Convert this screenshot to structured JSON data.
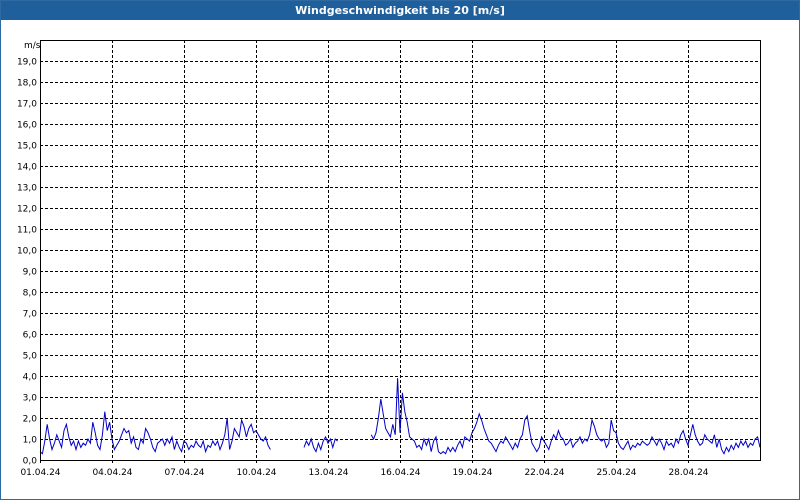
{
  "window": {
    "title": "Windgeschwindigkeit bis 20 [m/s]"
  },
  "chart_data": {
    "type": "line",
    "title": "Windgeschwindigkeit bis 20 [m/s]",
    "ylabel": "m/s",
    "xlabel": "",
    "ylim": [
      0,
      20
    ],
    "xlim_days": [
      0,
      30
    ],
    "grid": true,
    "y_ticks": [
      "0,0",
      "1,0",
      "2,0",
      "3,0",
      "4,0",
      "5,0",
      "6,0",
      "7,0",
      "8,0",
      "9,0",
      "10,0",
      "11,0",
      "12,0",
      "13,0",
      "14,0",
      "15,0",
      "16,0",
      "17,0",
      "18,0",
      "19,0"
    ],
    "x_ticks": [
      "01.04.24",
      "04.04.24",
      "07.04.24",
      "10.04.24",
      "13.04.24",
      "16.04.24",
      "19.04.24",
      "22.04.24",
      "25.04.24",
      "28.04.24"
    ],
    "colors": {
      "series": "#0000c8",
      "title_bar": "#1e5f9c"
    },
    "series": [
      {
        "segments": [
          [
            [
              0.0,
              0.4
            ],
            [
              0.1,
              0.3
            ],
            [
              0.2,
              0.9
            ],
            [
              0.3,
              1.7
            ],
            [
              0.4,
              1.0
            ],
            [
              0.5,
              0.5
            ],
            [
              0.6,
              0.8
            ],
            [
              0.7,
              1.2
            ],
            [
              0.8,
              0.9
            ],
            [
              0.9,
              0.6
            ],
            [
              1.0,
              1.4
            ],
            [
              1.1,
              1.7
            ],
            [
              1.2,
              1.1
            ],
            [
              1.3,
              0.7
            ],
            [
              1.4,
              0.9
            ],
            [
              1.5,
              0.5
            ],
            [
              1.6,
              0.9
            ],
            [
              1.7,
              0.6
            ],
            [
              1.8,
              0.8
            ],
            [
              1.9,
              0.7
            ],
            [
              2.0,
              1.0
            ],
            [
              2.1,
              0.8
            ],
            [
              2.2,
              1.8
            ],
            [
              2.3,
              1.3
            ],
            [
              2.4,
              0.7
            ],
            [
              2.5,
              0.5
            ],
            [
              2.6,
              1.2
            ],
            [
              2.7,
              2.3
            ],
            [
              2.8,
              1.4
            ],
            [
              2.9,
              1.8
            ],
            [
              3.0,
              1.0
            ],
            [
              3.1,
              0.5
            ],
            [
              3.2,
              0.7
            ],
            [
              3.3,
              0.9
            ],
            [
              3.4,
              1.2
            ],
            [
              3.5,
              1.5
            ],
            [
              3.6,
              1.3
            ],
            [
              3.7,
              1.4
            ],
            [
              3.8,
              0.8
            ],
            [
              3.9,
              1.1
            ],
            [
              4.0,
              0.6
            ],
            [
              4.1,
              0.5
            ],
            [
              4.2,
              1.0
            ],
            [
              4.3,
              0.8
            ],
            [
              4.4,
              1.5
            ],
            [
              4.5,
              1.3
            ],
            [
              4.6,
              1.0
            ],
            [
              4.7,
              0.6
            ],
            [
              4.8,
              0.4
            ],
            [
              4.9,
              0.8
            ],
            [
              5.0,
              0.9
            ],
            [
              5.1,
              1.0
            ],
            [
              5.2,
              0.7
            ],
            [
              5.3,
              1.0
            ],
            [
              5.4,
              0.8
            ],
            [
              5.5,
              1.1
            ],
            [
              5.6,
              0.5
            ],
            [
              5.7,
              0.9
            ],
            [
              5.8,
              0.6
            ],
            [
              5.9,
              0.4
            ],
            [
              6.0,
              0.9
            ],
            [
              6.1,
              0.8
            ],
            [
              6.2,
              0.5
            ],
            [
              6.3,
              0.7
            ],
            [
              6.4,
              0.6
            ],
            [
              6.5,
              0.9
            ],
            [
              6.6,
              0.7
            ],
            [
              6.7,
              0.6
            ],
            [
              6.8,
              0.9
            ],
            [
              6.9,
              0.4
            ],
            [
              7.0,
              0.7
            ],
            [
              7.1,
              0.6
            ],
            [
              7.2,
              0.9
            ],
            [
              7.3,
              0.7
            ],
            [
              7.4,
              0.9
            ],
            [
              7.5,
              0.5
            ],
            [
              7.6,
              0.8
            ],
            [
              7.7,
              1.2
            ],
            [
              7.8,
              2.0
            ],
            [
              7.9,
              0.5
            ],
            [
              8.0,
              0.9
            ],
            [
              8.1,
              1.5
            ],
            [
              8.2,
              1.3
            ],
            [
              8.3,
              1.1
            ],
            [
              8.4,
              1.9
            ],
            [
              8.5,
              1.6
            ],
            [
              8.6,
              1.1
            ],
            [
              8.7,
              1.5
            ],
            [
              8.8,
              1.7
            ],
            [
              8.9,
              1.3
            ],
            [
              9.0,
              1.4
            ],
            [
              9.1,
              1.2
            ],
            [
              9.2,
              1.0
            ],
            [
              9.3,
              0.9
            ],
            [
              9.4,
              1.1
            ],
            [
              9.5,
              0.7
            ],
            [
              9.6,
              0.5
            ]
          ],
          [
            [
              11.0,
              0.6
            ],
            [
              11.1,
              0.9
            ],
            [
              11.2,
              0.7
            ],
            [
              11.3,
              1.0
            ],
            [
              11.4,
              0.6
            ],
            [
              11.5,
              0.4
            ],
            [
              11.6,
              0.8
            ],
            [
              11.7,
              0.5
            ],
            [
              11.8,
              0.9
            ],
            [
              11.9,
              1.1
            ],
            [
              12.0,
              0.8
            ],
            [
              12.1,
              1.0
            ],
            [
              12.2,
              0.6
            ],
            [
              12.3,
              1.0
            ],
            [
              12.4,
              0.9
            ]
          ],
          [
            [
              13.8,
              1.2
            ],
            [
              13.9,
              1.0
            ],
            [
              14.0,
              1.3
            ],
            [
              14.1,
              2.0
            ],
            [
              14.2,
              2.9
            ],
            [
              14.3,
              2.2
            ],
            [
              14.4,
              1.5
            ],
            [
              14.5,
              1.3
            ],
            [
              14.6,
              1.1
            ],
            [
              14.7,
              1.7
            ],
            [
              14.8,
              1.2
            ],
            [
              14.9,
              3.9
            ],
            [
              15.0,
              1.3
            ],
            [
              15.1,
              3.2
            ],
            [
              15.2,
              2.3
            ],
            [
              15.3,
              1.8
            ],
            [
              15.4,
              1.1
            ],
            [
              15.5,
              1.0
            ],
            [
              15.6,
              0.9
            ],
            [
              15.7,
              0.6
            ],
            [
              15.8,
              0.7
            ],
            [
              15.9,
              0.5
            ],
            [
              16.0,
              1.0
            ],
            [
              16.1,
              0.7
            ],
            [
              16.2,
              1.0
            ],
            [
              16.3,
              0.4
            ],
            [
              16.4,
              0.9
            ],
            [
              16.5,
              1.1
            ],
            [
              16.6,
              0.4
            ],
            [
              16.7,
              0.3
            ],
            [
              16.8,
              0.4
            ],
            [
              16.9,
              0.3
            ],
            [
              17.0,
              0.6
            ],
            [
              17.1,
              0.4
            ],
            [
              17.2,
              0.6
            ],
            [
              17.3,
              0.4
            ],
            [
              17.4,
              0.7
            ],
            [
              17.5,
              0.9
            ],
            [
              17.6,
              0.6
            ],
            [
              17.7,
              1.1
            ],
            [
              17.8,
              1.0
            ],
            [
              17.9,
              0.9
            ],
            [
              18.0,
              1.3
            ],
            [
              18.1,
              1.5
            ],
            [
              18.2,
              1.8
            ],
            [
              18.3,
              2.2
            ],
            [
              18.4,
              1.9
            ],
            [
              18.5,
              1.5
            ],
            [
              18.6,
              1.2
            ],
            [
              18.7,
              0.9
            ],
            [
              18.8,
              0.8
            ],
            [
              18.9,
              0.6
            ],
            [
              19.0,
              0.4
            ],
            [
              19.1,
              0.7
            ],
            [
              19.2,
              0.9
            ],
            [
              19.3,
              0.8
            ],
            [
              19.4,
              1.1
            ],
            [
              19.5,
              0.9
            ],
            [
              19.6,
              0.7
            ],
            [
              19.7,
              0.5
            ],
            [
              19.8,
              0.8
            ],
            [
              19.9,
              0.6
            ],
            [
              20.0,
              1.0
            ],
            [
              20.1,
              1.2
            ],
            [
              20.2,
              1.9
            ],
            [
              20.3,
              2.1
            ],
            [
              20.4,
              1.4
            ],
            [
              20.5,
              0.8
            ],
            [
              20.6,
              0.6
            ],
            [
              20.7,
              0.4
            ],
            [
              20.8,
              0.6
            ],
            [
              20.9,
              1.1
            ],
            [
              21.0,
              0.9
            ],
            [
              21.1,
              0.7
            ],
            [
              21.2,
              0.5
            ],
            [
              21.3,
              0.9
            ],
            [
              21.4,
              1.2
            ],
            [
              21.5,
              1.0
            ],
            [
              21.6,
              1.4
            ],
            [
              21.7,
              1.1
            ],
            [
              21.8,
              1.0
            ],
            [
              21.9,
              0.7
            ],
            [
              22.0,
              0.8
            ],
            [
              22.1,
              1.0
            ],
            [
              22.2,
              0.6
            ],
            [
              22.3,
              0.8
            ],
            [
              22.4,
              0.9
            ],
            [
              22.5,
              1.1
            ],
            [
              22.6,
              0.8
            ],
            [
              22.7,
              1.0
            ],
            [
              22.8,
              0.9
            ],
            [
              22.9,
              1.2
            ],
            [
              23.0,
              1.9
            ],
            [
              23.1,
              1.6
            ],
            [
              23.2,
              1.2
            ],
            [
              23.3,
              1.0
            ],
            [
              23.4,
              0.9
            ],
            [
              23.5,
              1.0
            ],
            [
              23.6,
              0.6
            ],
            [
              23.7,
              0.8
            ],
            [
              23.8,
              1.9
            ],
            [
              23.9,
              1.4
            ],
            [
              24.0,
              1.3
            ],
            [
              24.1,
              0.8
            ],
            [
              24.2,
              0.6
            ],
            [
              24.3,
              0.5
            ],
            [
              24.4,
              0.7
            ],
            [
              24.5,
              0.9
            ],
            [
              24.6,
              0.5
            ],
            [
              24.7,
              0.7
            ],
            [
              24.8,
              0.6
            ],
            [
              24.9,
              0.8
            ],
            [
              25.0,
              0.7
            ],
            [
              25.1,
              0.9
            ],
            [
              25.2,
              0.8
            ],
            [
              25.3,
              0.7
            ],
            [
              25.4,
              0.8
            ],
            [
              25.5,
              1.1
            ],
            [
              25.6,
              0.9
            ],
            [
              25.7,
              0.7
            ],
            [
              25.8,
              1.0
            ],
            [
              25.9,
              0.8
            ],
            [
              26.0,
              0.5
            ],
            [
              26.1,
              0.9
            ],
            [
              26.2,
              0.7
            ],
            [
              26.3,
              0.8
            ],
            [
              26.4,
              0.6
            ],
            [
              26.5,
              1.0
            ],
            [
              26.6,
              0.8
            ],
            [
              26.7,
              1.2
            ],
            [
              26.8,
              1.4
            ],
            [
              26.9,
              1.0
            ],
            [
              27.0,
              0.7
            ],
            [
              27.1,
              1.2
            ],
            [
              27.2,
              1.7
            ],
            [
              27.3,
              1.2
            ],
            [
              27.4,
              0.9
            ],
            [
              27.5,
              0.7
            ],
            [
              27.6,
              0.8
            ],
            [
              27.7,
              1.2
            ],
            [
              27.8,
              1.0
            ],
            [
              27.9,
              0.9
            ],
            [
              28.0,
              0.8
            ],
            [
              28.1,
              1.2
            ],
            [
              28.2,
              0.6
            ],
            [
              28.3,
              1.0
            ],
            [
              28.4,
              0.5
            ],
            [
              28.5,
              0.3
            ],
            [
              28.6,
              0.6
            ],
            [
              28.7,
              0.4
            ],
            [
              28.8,
              0.7
            ],
            [
              28.9,
              0.5
            ],
            [
              29.0,
              0.8
            ],
            [
              29.1,
              0.6
            ],
            [
              29.2,
              0.9
            ],
            [
              29.3,
              0.7
            ],
            [
              29.4,
              0.9
            ],
            [
              29.5,
              0.6
            ],
            [
              29.6,
              0.8
            ],
            [
              29.7,
              0.7
            ],
            [
              29.8,
              1.0
            ],
            [
              29.9,
              1.1
            ],
            [
              30.0,
              0.6
            ]
          ]
        ]
      }
    ]
  }
}
